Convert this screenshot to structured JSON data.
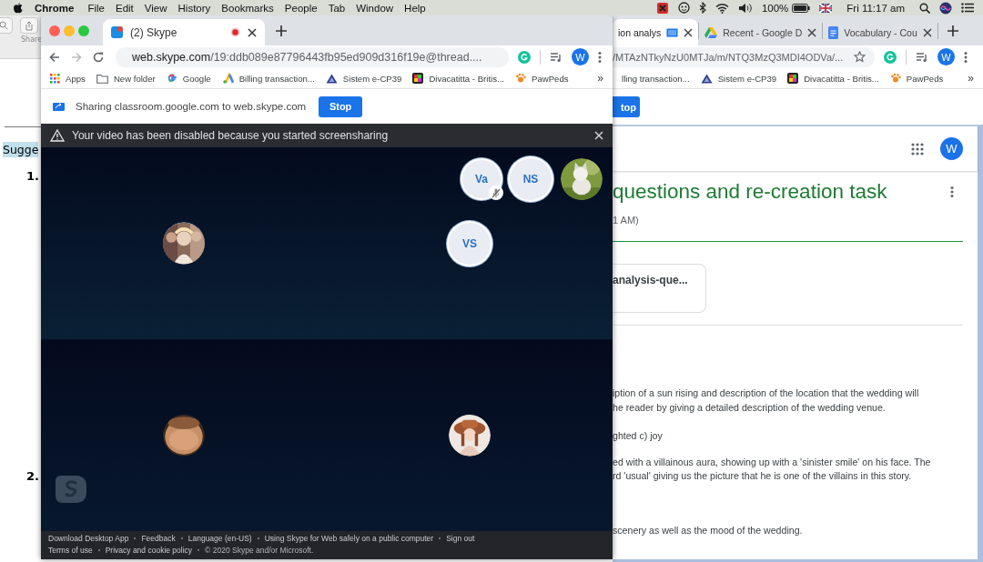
{
  "menu_bar": {
    "app_name": "Chrome",
    "menus": [
      "File",
      "Edit",
      "View",
      "History",
      "Bookmarks",
      "People",
      "Tab",
      "Window",
      "Help"
    ],
    "battery_percent": "100%",
    "clock": "Fri 11:17 am"
  },
  "document_window": {
    "toolbar_label": "Share",
    "heading": "Sugge",
    "list_numbers": [
      "1.",
      "2."
    ]
  },
  "skype_window": {
    "tab": {
      "title": "(2) Skype",
      "recording": true
    },
    "address": {
      "host": "web.skype.com",
      "path": "/19:ddb089e87796443fb95ed909d316f19e@thread...."
    },
    "profile_initial": "W",
    "bookmarks": [
      {
        "kind": "apps",
        "label": "Apps"
      },
      {
        "kind": "folder",
        "label": "New folder"
      },
      {
        "kind": "google",
        "label": "Google"
      },
      {
        "kind": "ads",
        "label": "Billing transaction..."
      },
      {
        "kind": "triangle",
        "label": "Sistem e-CP39"
      },
      {
        "kind": "tile",
        "label": "Divacatitta - Britis..."
      },
      {
        "kind": "paw",
        "label": "PawPeds"
      }
    ],
    "more_bookmarks": "»",
    "sharing_bar": {
      "message": "Sharing classroom.google.com to web.skype.com",
      "button": "Stop"
    },
    "notice": "Your video has been disabled because you started screensharing",
    "call": {
      "roster": [
        {
          "kind": "initials",
          "initials": "Va",
          "muted": true
        },
        {
          "kind": "initials",
          "initials": "NS",
          "muted": false
        },
        {
          "kind": "picture",
          "muted": false
        }
      ],
      "tiles": [
        {
          "kind": "picture",
          "muted": false
        },
        {
          "kind": "initials",
          "initials": "VS",
          "muted": false
        },
        {
          "kind": "picture",
          "muted": false
        },
        {
          "kind": "picture",
          "muted": false
        }
      ]
    },
    "footer": {
      "rows": [
        [
          {
            "kind": "link",
            "label": "Download Desktop App"
          },
          {
            "kind": "link",
            "label": "Feedback"
          },
          {
            "kind": "link",
            "label": "Language (en-US)"
          },
          {
            "kind": "link",
            "label": "Using Skype for Web safely on a public computer"
          },
          {
            "kind": "link",
            "label": "Sign out"
          }
        ],
        [
          {
            "kind": "link",
            "label": "Terms of use"
          },
          {
            "kind": "link",
            "label": "Privacy and cookie policy"
          },
          {
            "kind": "text",
            "label": "© 2020 Skype and/or Microsoft."
          }
        ]
      ]
    }
  },
  "classroom_window": {
    "tabs": [
      {
        "kind": "sharing",
        "label": "ion analys",
        "selected": true
      },
      {
        "kind": "drive",
        "label": "Recent - Google D",
        "selected": false
      },
      {
        "kind": "docs",
        "label": "Vocabulary - Cou",
        "selected": false
      }
    ],
    "address": "/MTAzNTkyNzU0MTJa/m/NTQ3MzQ3MDI4ODVa/...",
    "profile_initial": "W",
    "bookmarks": [
      {
        "kind": "plain",
        "label": "lling transaction..."
      },
      {
        "kind": "triangle",
        "label": "Sistem e-CP39"
      },
      {
        "kind": "tile",
        "label": "Divacatitta - Britis..."
      },
      {
        "kind": "paw",
        "label": "PawPeds"
      }
    ],
    "more_bookmarks": "»",
    "sharing_button": "top",
    "account_initial": "W",
    "title": "questions and re-creation task",
    "posted": "1 AM)",
    "attachment": "analysis-que...",
    "answers": [
      [
        "iption of a sun rising and description of the location that the wedding will",
        "he reader by giving a detailed description of the wedding venue."
      ],
      [
        "ghted c) joy"
      ],
      [
        "ed with a villainous aura, showing up with a 'sinister smile' on his face. The",
        "rd 'usual' giving us the picture that he is one of the villains in this story."
      ],
      [
        "scenery as well as the mood of the wedding."
      ]
    ]
  }
}
